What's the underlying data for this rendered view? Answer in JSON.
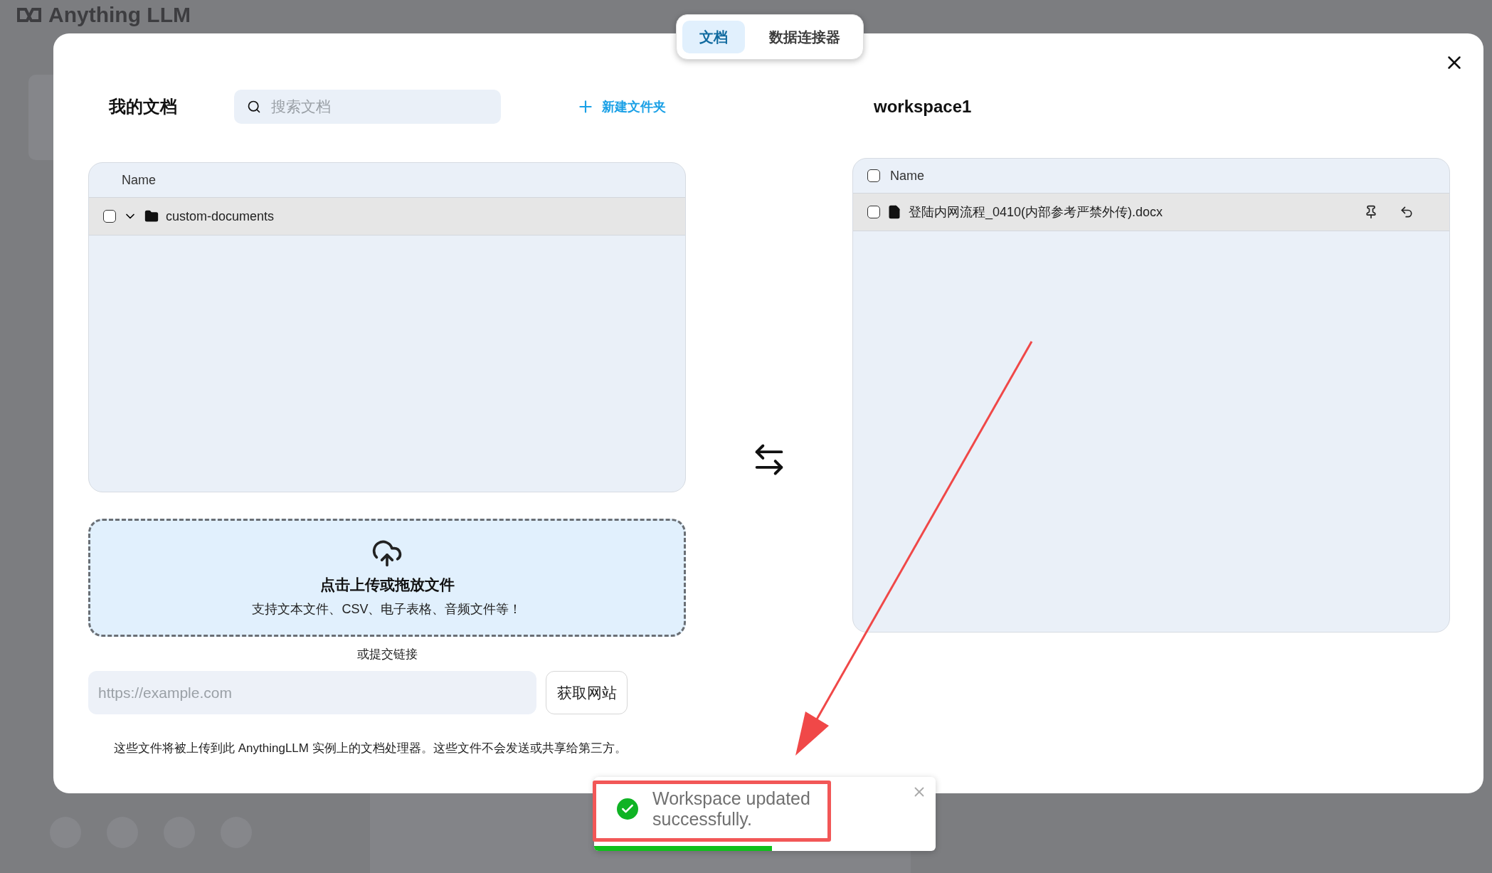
{
  "background": {
    "logo": "Anything LLM"
  },
  "tabs": [
    {
      "label": "文档",
      "selected": true
    },
    {
      "label": "数据连接器",
      "selected": false
    }
  ],
  "my_documents": {
    "title": "我的文档",
    "search": {
      "placeholder": "搜索文档"
    },
    "new_folder": "新建文件夹",
    "table": {
      "columns": [
        "Name"
      ],
      "rows": [
        {
          "name": "custom-documents",
          "kind": "folder",
          "checked": false,
          "expanded": true
        }
      ]
    }
  },
  "upload": {
    "title": "点击上传或拖放文件",
    "subtitle": "支持文本文件、CSV、电子表格、音频文件等！",
    "or_link": "或提交链接",
    "url": {
      "placeholder": "https://example.com"
    },
    "fetch_button": "获取网站",
    "notice": "这些文件将被上传到此 AnythingLLM 实例上的文档处理器。这些文件不会发送或共享给第三方。"
  },
  "workspace": {
    "title": "workspace1",
    "table": {
      "columns": [
        "Name"
      ],
      "header_checked": false,
      "rows": [
        {
          "name": "登陆内网流程_0410(内部参考严禁外传).docx",
          "kind": "file",
          "checked": false
        }
      ]
    }
  },
  "toast": {
    "message": "Workspace updated successfully.",
    "level": 0.52
  }
}
